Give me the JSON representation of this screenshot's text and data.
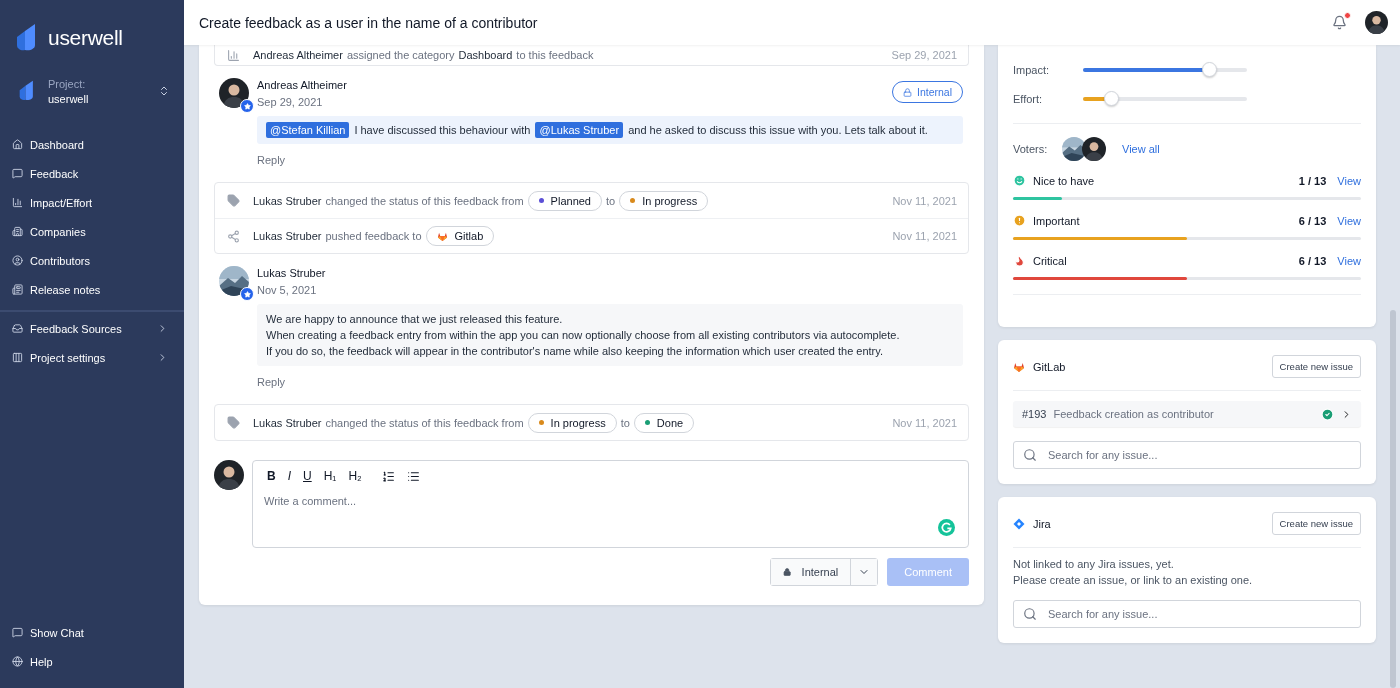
{
  "sidebar": {
    "logo": "userwell",
    "project": {
      "label": "Project:",
      "name": "userwell"
    },
    "nav": [
      {
        "label": "Dashboard",
        "expandable": false
      },
      {
        "label": "Feedback",
        "expandable": false
      },
      {
        "label": "Impact/Effort",
        "expandable": false
      },
      {
        "label": "Companies",
        "expandable": false
      },
      {
        "label": "Contributors",
        "expandable": false
      },
      {
        "label": "Release notes",
        "expandable": false
      }
    ],
    "sections": [
      {
        "label": "Feedback Sources",
        "expandable": true
      },
      {
        "label": "Project settings",
        "expandable": true
      }
    ],
    "footer": [
      {
        "label": "Show Chat"
      },
      {
        "label": "Help"
      }
    ]
  },
  "header": {
    "title": "Create feedback as a user in the name of a contributor",
    "has_notification": true
  },
  "timeline": [
    {
      "kind": "events",
      "rows": [
        {
          "kind": "category",
          "date": "Sep 29, 2021",
          "parts": [
            {
              "kind": "actor",
              "text": "Andreas Altheimer"
            },
            {
              "kind": "text",
              "text": "assigned the category"
            },
            {
              "kind": "actor",
              "text": "Dashboard"
            },
            {
              "kind": "text",
              "text": "to this feedback"
            }
          ]
        }
      ]
    },
    {
      "kind": "comment",
      "author": "Andreas Altheimer",
      "date": "Sep 29, 2021",
      "internal": true,
      "badge": "Internal",
      "reply": "Reply",
      "lines": [
        [
          {
            "kind": "mention",
            "text": "@Stefan Killian"
          },
          {
            "kind": "text",
            "text": "I have discussed this behaviour with"
          },
          {
            "kind": "mention",
            "text": "@Lukas Struber"
          },
          {
            "kind": "text",
            "text": "and he asked to discuss this issue with you. Lets talk about it."
          }
        ]
      ]
    },
    {
      "kind": "events",
      "rows": [
        {
          "kind": "status",
          "date": "Nov 11, 2021",
          "parts": [
            {
              "kind": "actor",
              "text": "Lukas Struber"
            },
            {
              "kind": "text",
              "text": "changed the status of this feedback from"
            },
            {
              "kind": "status",
              "text": "Planned",
              "color": "#5b4fd6"
            },
            {
              "kind": "text",
              "text": "to"
            },
            {
              "kind": "status",
              "text": "In progress",
              "color": "#d98a1c"
            }
          ]
        },
        {
          "kind": "push",
          "date": "Nov 11, 2021",
          "parts": [
            {
              "kind": "actor",
              "text": "Lukas Struber"
            },
            {
              "kind": "text",
              "text": "pushed feedback to"
            },
            {
              "kind": "integration",
              "text": "Gitlab"
            }
          ]
        }
      ]
    },
    {
      "kind": "comment",
      "author": "Lukas Struber",
      "date": "Nov 5, 2021",
      "internal": false,
      "reply": "Reply",
      "lines": [
        [
          {
            "kind": "text",
            "text": "We are happy to announce that we just released this feature."
          }
        ],
        [
          {
            "kind": "text",
            "text": "When creating a feedback entry from within the app you can now optionally choose from all existing contributors via autocomplete."
          }
        ],
        [
          {
            "kind": "text",
            "text": "If you do so, the feedback will appear in the contributor's name while also keeping the information which user created the entry."
          }
        ]
      ]
    },
    {
      "kind": "events",
      "rows": [
        {
          "kind": "status",
          "date": "Nov 11, 2021",
          "parts": [
            {
              "kind": "actor",
              "text": "Lukas Struber"
            },
            {
              "kind": "text",
              "text": "changed the status of this feedback from"
            },
            {
              "kind": "status",
              "text": "In progress",
              "color": "#d98a1c"
            },
            {
              "kind": "text",
              "text": "to"
            },
            {
              "kind": "status",
              "text": "Done",
              "color": "#1a9e75"
            }
          ]
        }
      ]
    }
  ],
  "editor": {
    "toolbar": [
      {
        "kind": "bold",
        "label": "B"
      },
      {
        "kind": "italic",
        "label": "I"
      },
      {
        "kind": "underline",
        "label": "U"
      },
      {
        "kind": "heading",
        "label": "H₁"
      },
      {
        "kind": "heading",
        "label": "H₂"
      },
      {
        "kind": "ordered-list"
      },
      {
        "kind": "bullet-list"
      }
    ],
    "placeholder": "Write a comment...",
    "visibility": "Internal",
    "submit": {
      "label": "Comment",
      "disabled": true
    }
  },
  "rating": {
    "sliders": [
      {
        "label": "Impact:",
        "level": 0.77,
        "color": "#3b76e1"
      },
      {
        "label": "Effort:",
        "level": 0.17,
        "color": "#e8a21f"
      }
    ],
    "voters": {
      "label": "Voters:",
      "link": "View all"
    },
    "votes": [
      {
        "label": "Nice to have",
        "count": "1 / 13",
        "link": "View",
        "level": 0.14,
        "color": "#2ec4a0"
      },
      {
        "label": "Important",
        "count": "6 / 13",
        "link": "View",
        "level": 0.5,
        "color": "#e8a21f"
      },
      {
        "label": "Critical",
        "count": "6 / 13",
        "link": "View",
        "level": 0.5,
        "color": "#e0473c"
      }
    ]
  },
  "integrations": [
    {
      "kind": "gitlab",
      "title": "GitLab",
      "button": "Create new issue",
      "issues": [
        {
          "number": "#193",
          "title": "Feedback creation as contributor",
          "done": true
        }
      ],
      "placeholder": "Search for any issue..."
    },
    {
      "kind": "jira",
      "title": "Jira",
      "button": "Create new issue",
      "message": [
        "Not linked to any Jira issues, yet.",
        "Please create an issue, or link to an existing one."
      ],
      "placeholder": "Search for any issue..."
    }
  ]
}
